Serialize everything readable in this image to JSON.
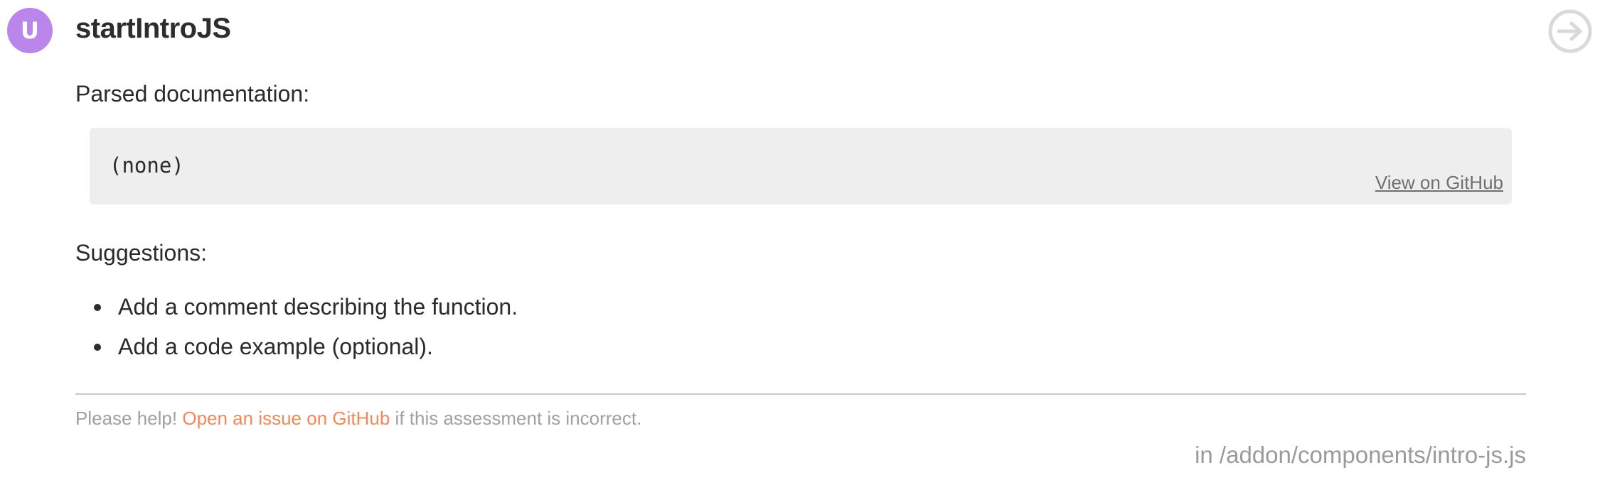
{
  "header": {
    "badge_letter": "U",
    "badge_color": "#bb86ec",
    "title": "startIntroJS",
    "nav_icon": "arrow-right-circle-icon"
  },
  "documentation": {
    "label": "Parsed documentation:",
    "code": "(none)",
    "github_link": "View on GitHub"
  },
  "suggestions": {
    "label": "Suggestions:",
    "items": [
      "Add a comment describing the function.",
      "Add a code example (optional)."
    ]
  },
  "footer": {
    "help_prefix": "Please help!",
    "help_link": "Open an issue on GitHub",
    "help_suffix": "if this assessment is incorrect.",
    "link_color": "#f3875a",
    "file_path": "in /addon/components/intro-js.js"
  }
}
